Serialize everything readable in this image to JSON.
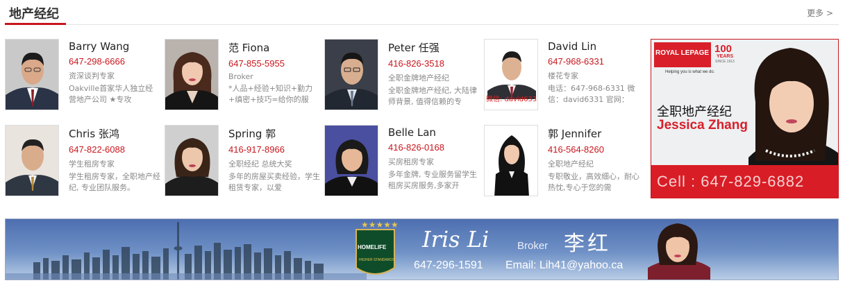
{
  "header": {
    "title": "地产经纪",
    "more": "更多 >"
  },
  "agents": [
    {
      "name": "Barry Wang",
      "phone": "647-298-6666",
      "role": "资深谈判专家",
      "desc": "Oakville首家华人独立经营地产公司 ★专攻"
    },
    {
      "name": "范 Fiona",
      "phone": "647-855-5955",
      "role": "Broker",
      "desc": "*人品+经验+知识+勤力+缜密+技巧=给你的服"
    },
    {
      "name": "Peter 任强",
      "phone": "416-826-3518",
      "role": "全职金牌地产经纪",
      "desc": "全职金牌地产经纪, 大陆律师背景, 值得信赖的专"
    },
    {
      "name": "David Lin",
      "phone": "647-968-6331",
      "role": "楼花专家",
      "desc": "电话：647-968-6331 微信：david6331 官网："
    },
    {
      "name": "Chris 张鸿",
      "phone": "647-822-6088",
      "role": "学生租房专家",
      "desc": "学生租房专家，全职地产经纪, 专业团队服务。"
    },
    {
      "name": "Spring 郭",
      "phone": "416-917-8966",
      "role": "全职经纪 总统大奖",
      "desc": "多年的房屋买卖经验，学生租赁专家，以爱"
    },
    {
      "name": "Belle Lan",
      "phone": "416-826-0168",
      "role": "买房租房专家",
      "desc": "多年金牌, 专业服务留学生租房买房服务,多家开"
    },
    {
      "name": "郭 Jennifer",
      "phone": "416-564-8260",
      "role": "全职地产经纪",
      "desc": "专职敬业，高效细心，耐心热忱,专心于您的需"
    }
  ],
  "photo_overlays": {
    "david_wechat": "微信: david6331"
  },
  "ad_right": {
    "brand_left": "ROYAL LEPAGE",
    "brand_years": "100",
    "brand_years_label": "YEARS",
    "brand_since": "SINCE 1913",
    "tagline": "Helping you is what we do.",
    "title_cn": "全职地产经纪",
    "name_en": "Jessica Zhang",
    "cell": "Cell : 647-829-6882"
  },
  "banner": {
    "name_script": "Iris Li",
    "title": "Broker",
    "name_cn": "李红",
    "phone": "647-296-1591",
    "email": "Email: Lih41@yahoo.ca",
    "logo_text": "HOMELIFE",
    "logo_sub": "HIGHER STANDARDS"
  },
  "colors": {
    "accent": "#c8161d",
    "banner_blue": "#4e6fb0"
  }
}
